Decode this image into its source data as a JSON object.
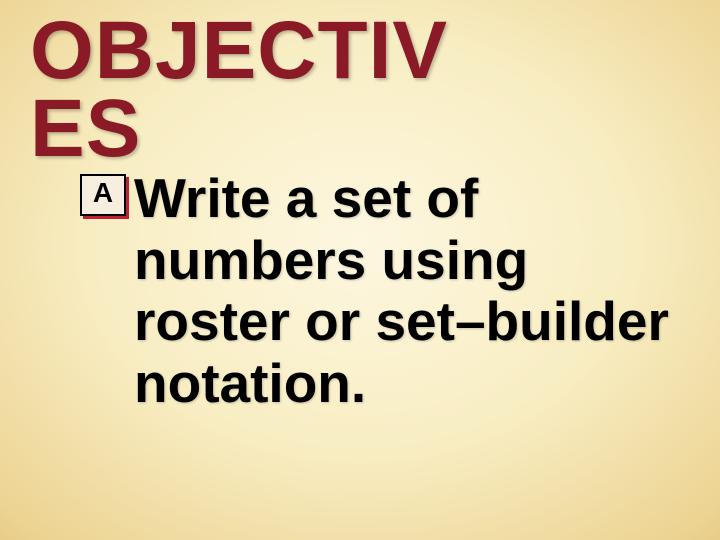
{
  "heading": "OBJECTIVES",
  "item": {
    "label": "A",
    "text": "Write a set of numbers using roster or set–builder notation."
  }
}
